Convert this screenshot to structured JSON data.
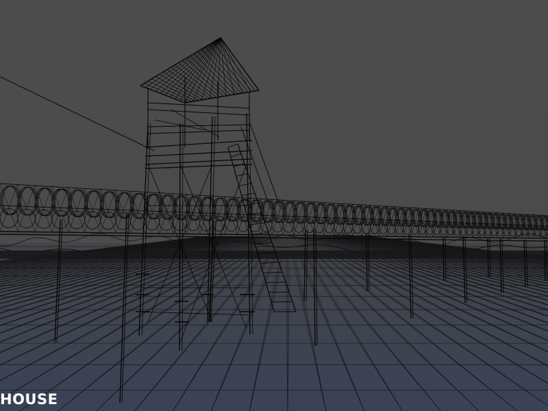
{
  "viewport": {
    "mode": "wireframe",
    "background_color": "#4a4a4a",
    "sky_color": "#4a4a4a",
    "ground_color": "#3c4454",
    "wire_color": "#0a0a0a"
  },
  "scene": {
    "objects": [
      {
        "name": "watchtower",
        "type": "tower"
      },
      {
        "name": "barbed-wire-fence",
        "type": "fence"
      },
      {
        "name": "fence-posts",
        "type": "posts"
      },
      {
        "name": "terrain-grid",
        "type": "terrain"
      }
    ]
  },
  "watermark": {
    "text": "HOUSE"
  }
}
